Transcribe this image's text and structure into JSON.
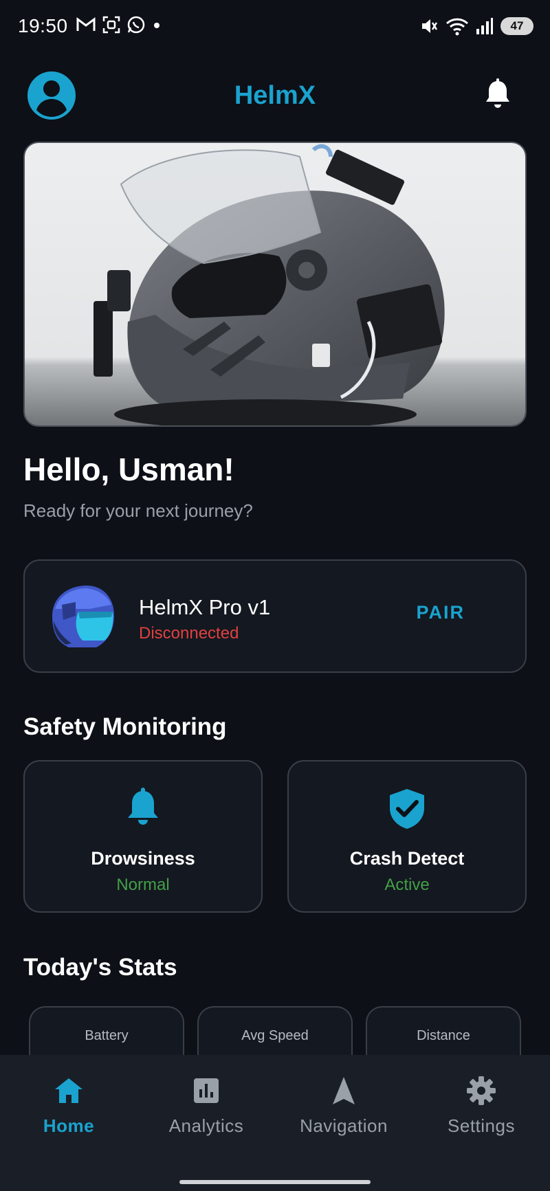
{
  "status_bar": {
    "time": "19:50",
    "battery": "47"
  },
  "header": {
    "title": "HelmX"
  },
  "hero": {
    "image": "helmet-with-sensors-photo"
  },
  "greeting": {
    "title": "Hello, Usman!",
    "subtitle": "Ready for your next journey?"
  },
  "device": {
    "name": "HelmX Pro v1",
    "status": "Disconnected",
    "action": "PAIR"
  },
  "safety": {
    "title": "Safety Monitoring",
    "cards": [
      {
        "label": "Drowsiness",
        "value": "Normal",
        "icon": "bell-icon"
      },
      {
        "label": "Crash Detect",
        "value": "Active",
        "icon": "shield-check-icon"
      }
    ]
  },
  "stats": {
    "title": "Today's Stats",
    "cards": [
      {
        "label": "Battery"
      },
      {
        "label": "Avg Speed"
      },
      {
        "label": "Distance"
      }
    ]
  },
  "nav": {
    "items": [
      {
        "label": "Home",
        "icon": "home-icon",
        "active": true
      },
      {
        "label": "Analytics",
        "icon": "analytics-icon",
        "active": false
      },
      {
        "label": "Navigation",
        "icon": "navigation-icon",
        "active": false
      },
      {
        "label": "Settings",
        "icon": "settings-icon",
        "active": false
      }
    ]
  },
  "colors": {
    "background": "#0d1017",
    "accent": "#1aa3cf",
    "danger": "#e0413f",
    "success": "#43a047",
    "card": "#141820"
  }
}
